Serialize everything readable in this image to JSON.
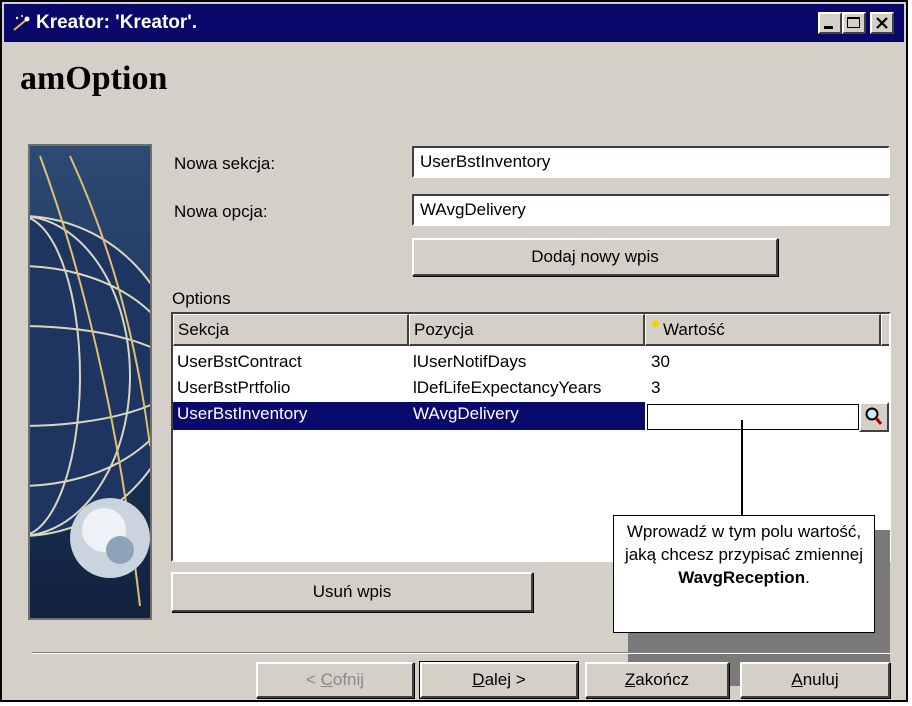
{
  "window": {
    "title": "Kreator: 'Kreator'."
  },
  "page": {
    "heading": "amOption"
  },
  "form": {
    "section_label": "Nowa sekcja:",
    "section_value": "UserBstInventory",
    "option_label": "Nowa opcja:",
    "option_value": "WAvgDelivery",
    "add_button": "Dodaj nowy wpis"
  },
  "options": {
    "group_label": "Options",
    "columns": [
      "Sekcja",
      "Pozycja",
      "Wartość"
    ],
    "rows": [
      {
        "section": "UserBstContract",
        "position": "lUserNotifDays",
        "value": "30"
      },
      {
        "section": "UserBstPrtfolio",
        "position": "lDefLifeExpectancyYears",
        "value": "3"
      },
      {
        "section": "UserBstInventory",
        "position": "WAvgDelivery",
        "value": ""
      }
    ],
    "selected_row": 3,
    "remove_button": "Usuń wpis"
  },
  "callout": {
    "text": "Wprowadź w tym polu wartość, jaką chcesz przypisać zmiennej",
    "bold": "WavgReception",
    "end": "."
  },
  "footer": {
    "back": {
      "prefix": "< ",
      "accel": "C",
      "rest": "ofnij"
    },
    "next": {
      "accel": "D",
      "rest": "alej >"
    },
    "finish": {
      "accel": "Z",
      "rest": "akończ"
    },
    "cancel": {
      "accel": "A",
      "rest": "nuluj"
    }
  },
  "colors": {
    "titlebar": "#08086b",
    "selection": "#0a0a6e",
    "face": "#d4d0c8"
  },
  "icons": [
    "wizard-icon",
    "minimize-icon",
    "maximize-icon",
    "close-icon",
    "magnifier-icon",
    "required-dot-icon"
  ]
}
